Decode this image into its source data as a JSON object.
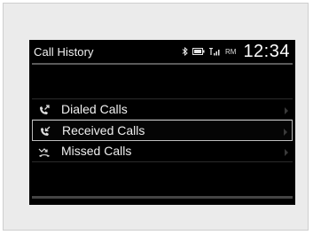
{
  "header": {
    "title": "Call History",
    "rm_label": "RM",
    "clock": "12:34"
  },
  "list": {
    "items": [
      {
        "label": "Dialed Calls",
        "icon": "dialed-call-icon"
      },
      {
        "label": "Received Calls",
        "icon": "received-call-icon",
        "selected": true
      },
      {
        "label": "Missed Calls",
        "icon": "missed-call-icon"
      }
    ]
  },
  "colors": {
    "screen_background": "#000000",
    "text": "#f0f0f0",
    "selection_border": "#bdbdbd"
  }
}
